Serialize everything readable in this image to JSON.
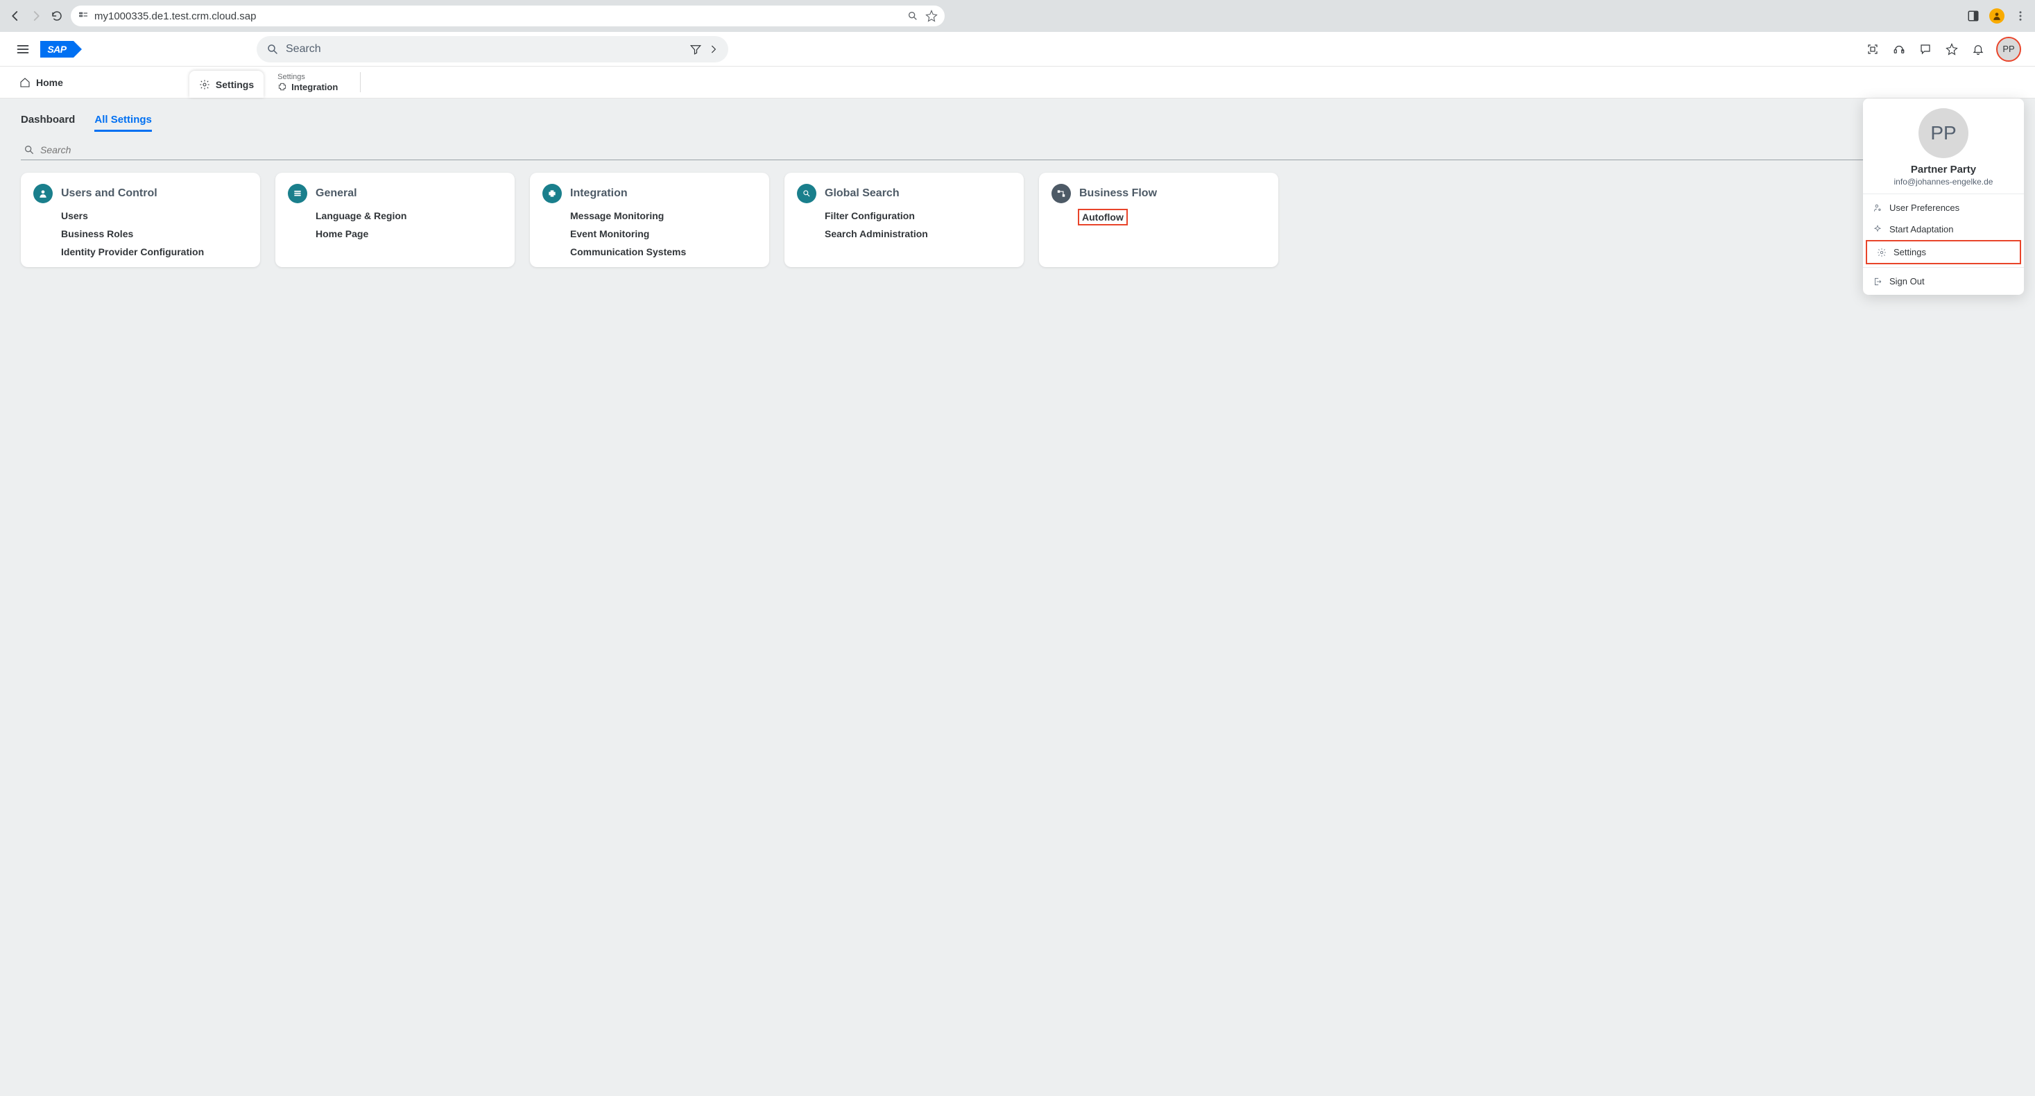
{
  "browser": {
    "url": "my1000335.de1.test.crm.cloud.sap"
  },
  "header": {
    "logo_text": "SAP",
    "search_placeholder": "Search",
    "avatar_initials": "PP"
  },
  "breadcrumb": {
    "home": "Home",
    "settings": "Settings",
    "sub_label": "Settings",
    "sub_value": "Integration"
  },
  "page_tabs": {
    "dashboard": "Dashboard",
    "all_settings": "All Settings"
  },
  "filter": {
    "placeholder": "Search"
  },
  "cards": [
    {
      "id": "users-control",
      "title": "Users and Control",
      "icon": "user",
      "items": [
        {
          "label": "Users"
        },
        {
          "label": "Business Roles"
        },
        {
          "label": "Identity Provider Configuration"
        }
      ]
    },
    {
      "id": "general",
      "title": "General",
      "icon": "stack",
      "items": [
        {
          "label": "Language & Region"
        },
        {
          "label": "Home Page"
        }
      ]
    },
    {
      "id": "integration",
      "title": "Integration",
      "icon": "puzzle",
      "items": [
        {
          "label": "Message Monitoring"
        },
        {
          "label": "Event Monitoring"
        },
        {
          "label": "Communication Systems"
        }
      ]
    },
    {
      "id": "global-search",
      "title": "Global Search",
      "icon": "magnify",
      "items": [
        {
          "label": "Filter Configuration"
        },
        {
          "label": "Search Administration"
        }
      ]
    },
    {
      "id": "business-flow",
      "title": "Business Flow",
      "icon": "flow",
      "items": [
        {
          "label": "Autoflow",
          "highlight": true
        }
      ]
    }
  ],
  "popover": {
    "avatar": "PP",
    "name": "Partner Party",
    "email": "info@johannes-engelke.de",
    "items": {
      "user_prefs": "User Preferences",
      "start_adapt": "Start Adaptation",
      "settings": "Settings",
      "sign_out": "Sign Out"
    }
  }
}
